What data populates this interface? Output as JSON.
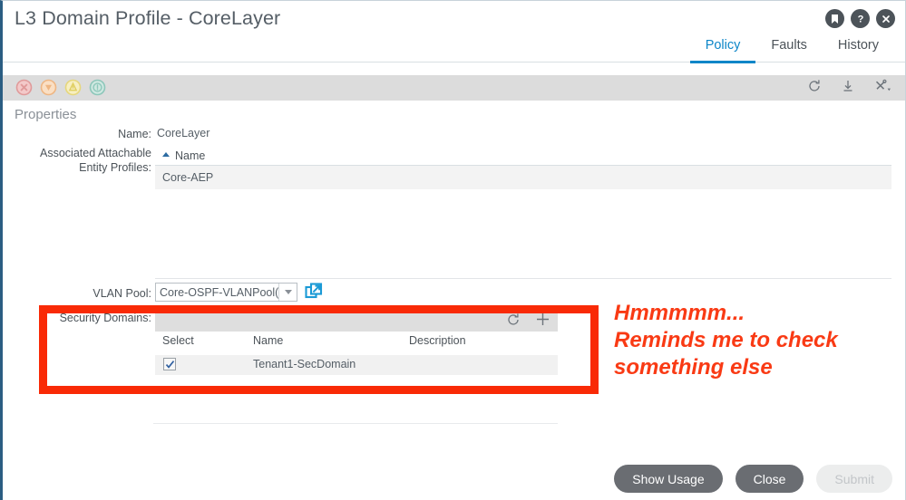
{
  "window": {
    "title": "L3 Domain Profile - CoreLayer",
    "icons": [
      {
        "name": "bookmark-icon",
        "glyph": "bookmark"
      },
      {
        "name": "help-icon",
        "glyph": "question"
      },
      {
        "name": "close-icon",
        "glyph": "close"
      }
    ]
  },
  "tabs": [
    {
      "label": "Policy",
      "active": true
    },
    {
      "label": "Faults",
      "active": false
    },
    {
      "label": "History",
      "active": false
    }
  ],
  "toolbar": {
    "severity_icons": [
      {
        "name": "critical-fault-icon",
        "color": "#d95c5c"
      },
      {
        "name": "major-fault-icon",
        "color": "#e8994b"
      },
      {
        "name": "minor-fault-icon",
        "color": "#e3cf4f"
      },
      {
        "name": "warning-fault-icon",
        "color": "#6ec0b0"
      }
    ],
    "refresh_label": "Refresh",
    "download_label": "Download",
    "actions_label": "Actions"
  },
  "properties": {
    "section_title": "Properties",
    "name_label": "Name:",
    "name_value": "CoreLayer",
    "aep_label": "Associated Attachable Entity Profiles:",
    "aep_column_name": "Name",
    "aep_rows": [
      {
        "name": "Core-AEP"
      }
    ],
    "vlan_pool_label": "VLAN Pool:",
    "vlan_pool_value": "Core-OSPF-VLANPool(s",
    "vlan_pool_link_name": "open-vlan-pool-icon"
  },
  "security_domains": {
    "label": "Security Domains:",
    "refresh_label": "Refresh",
    "add_label": "Add",
    "columns": [
      "Select",
      "Name",
      "Description"
    ],
    "rows": [
      {
        "selected": true,
        "name": "Tenant1-SecDomain",
        "description": ""
      }
    ]
  },
  "annotation": {
    "line1": "Hmmmmm...",
    "line2": "Reminds me to check",
    "line3": "something else",
    "color": "#f93a14"
  },
  "footer": {
    "show_usage": "Show Usage",
    "close": "Close",
    "submit": "Submit"
  },
  "colors": {
    "accent_blue": "#0d86c8",
    "toolbar_gray": "#dcdcdc",
    "text_gray": "#4c5359",
    "annotation_red": "#f92a06"
  }
}
